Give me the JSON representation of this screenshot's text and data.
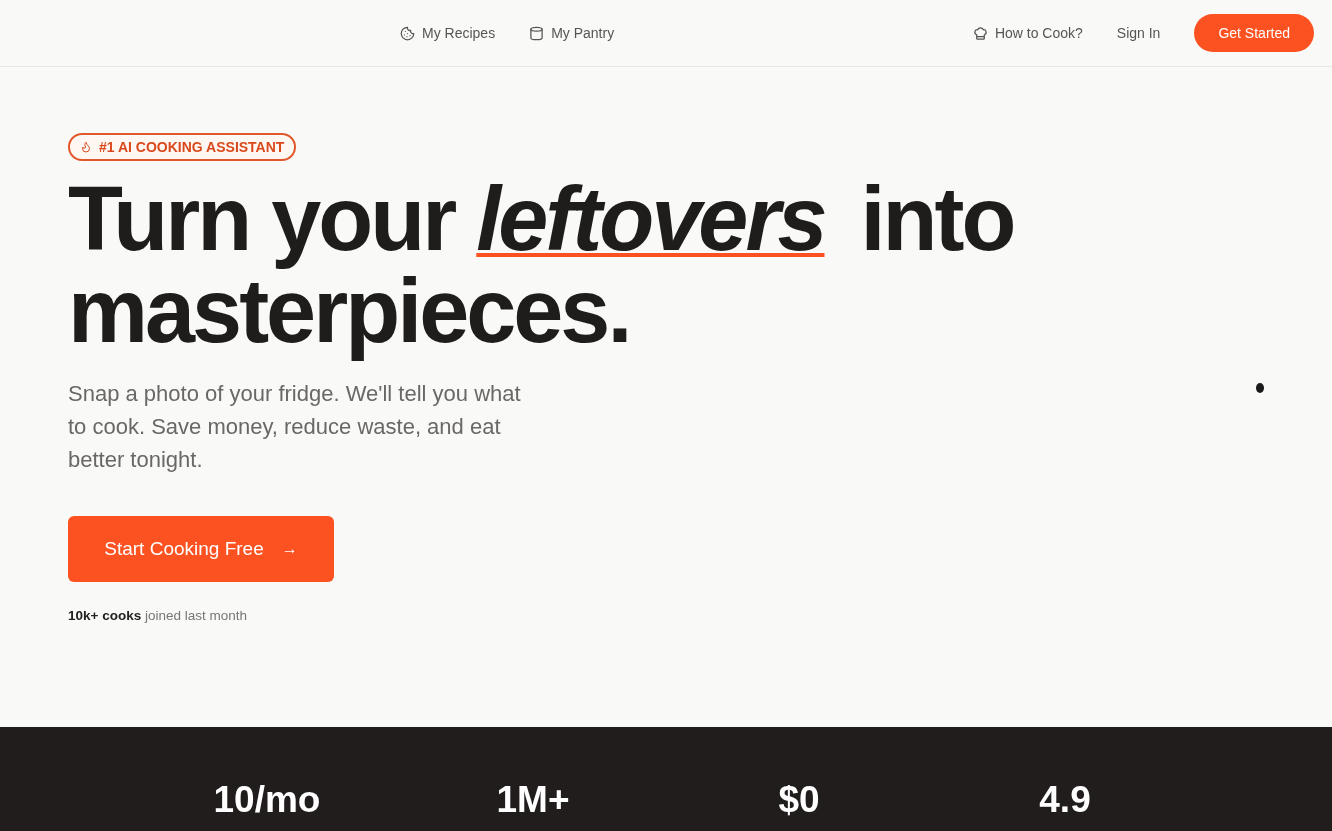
{
  "nav": {
    "center_links": [
      {
        "label": "My Recipes"
      },
      {
        "label": "My Pantry"
      }
    ],
    "right_links": [
      {
        "label": "How to Cook?"
      },
      {
        "label": "Sign In"
      }
    ],
    "cta": "Get Started"
  },
  "hero": {
    "badge": "#1 AI COOKING ASSISTANT",
    "headline": "Turn your *leftovers* into masterpieces.",
    "subtitle": "Snap a photo of your fridge. We'll tell you what to cook. Save money, reduce waste, and eat better tonight.",
    "button": "Start Cooking Free",
    "button_arrow": "→",
    "social_proof": "**10k+ cooks** joined last month"
  },
  "stats": [
    "10/mo",
    "1M+",
    "$0",
    "4.9"
  ]
}
